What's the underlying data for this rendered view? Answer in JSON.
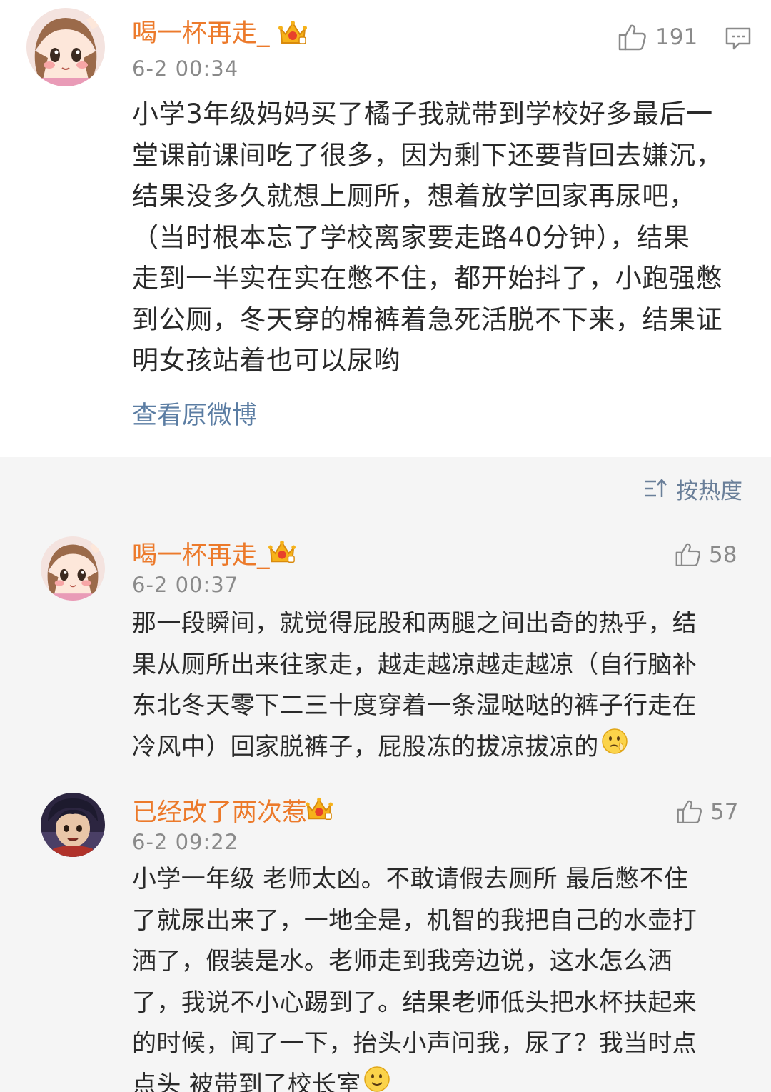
{
  "main_post": {
    "username": "喝一杯再走_",
    "timestamp": "6-2 00:34",
    "like_count": "191",
    "body_lines": [
      "小学3年级妈妈买了橘子我就带到学校好多最后一",
      "堂课前课间吃了很多，因为剩下还要背回去嫌沉，",
      "结果没多久就想上厕所，想着放学回家再尿吧，",
      "（当时根本忘了学校离家要走路40分钟），结果",
      "走到一半实在实在憋不住，都开始抖了，小跑强憋",
      "到公厕，冬天穿的棉裤着急死活脱不下来，结果证",
      "明女孩站着也可以尿哟"
    ],
    "view_original": "查看原微博"
  },
  "sort": {
    "label": "按热度"
  },
  "comments": [
    {
      "username": "喝一杯再走_",
      "timestamp": "6-2 00:37",
      "like_count": "58",
      "body_lines": [
        "那一段瞬间，就觉得屁股和两腿之间出奇的热乎，结",
        "果从厕所出来往家走，越走越凉越走越凉（自行脑补",
        "东北冬天零下二三十度穿着一条湿哒哒的裤子行走在",
        "冷风中）回家脱裤子，屁股冻的拔凉拔凉的"
      ]
    },
    {
      "username": "已经改了两次惹",
      "timestamp": "6-2 09:22",
      "like_count": "57",
      "body_lines": [
        "小学一年级 老师太凶。不敢请假去厕所 最后憋不住",
        "了就尿出来了，一地全是，机智的我把自己的水壶打",
        "洒了，假装是水。老师走到我旁边说，这水怎么洒",
        "了，我说不小心踢到了。结果老师低头把水杯扶起来",
        "的时候，闻了一下，抬头小声问我，尿了？我当时点",
        "点头 被带到了校长室"
      ]
    }
  ],
  "colors": {
    "username": "#ec7a2b",
    "link": "#5b7da3",
    "meta": "#8a8a8a",
    "body": "#2a2a2a",
    "comments_bg": "#f5f5f5"
  },
  "icons": [
    "avatar-anime-girl",
    "avatar-anime-boy",
    "vip-crown-icon",
    "thumbs-up-icon",
    "comment-icon",
    "sort-icon",
    "emoji-icon"
  ]
}
